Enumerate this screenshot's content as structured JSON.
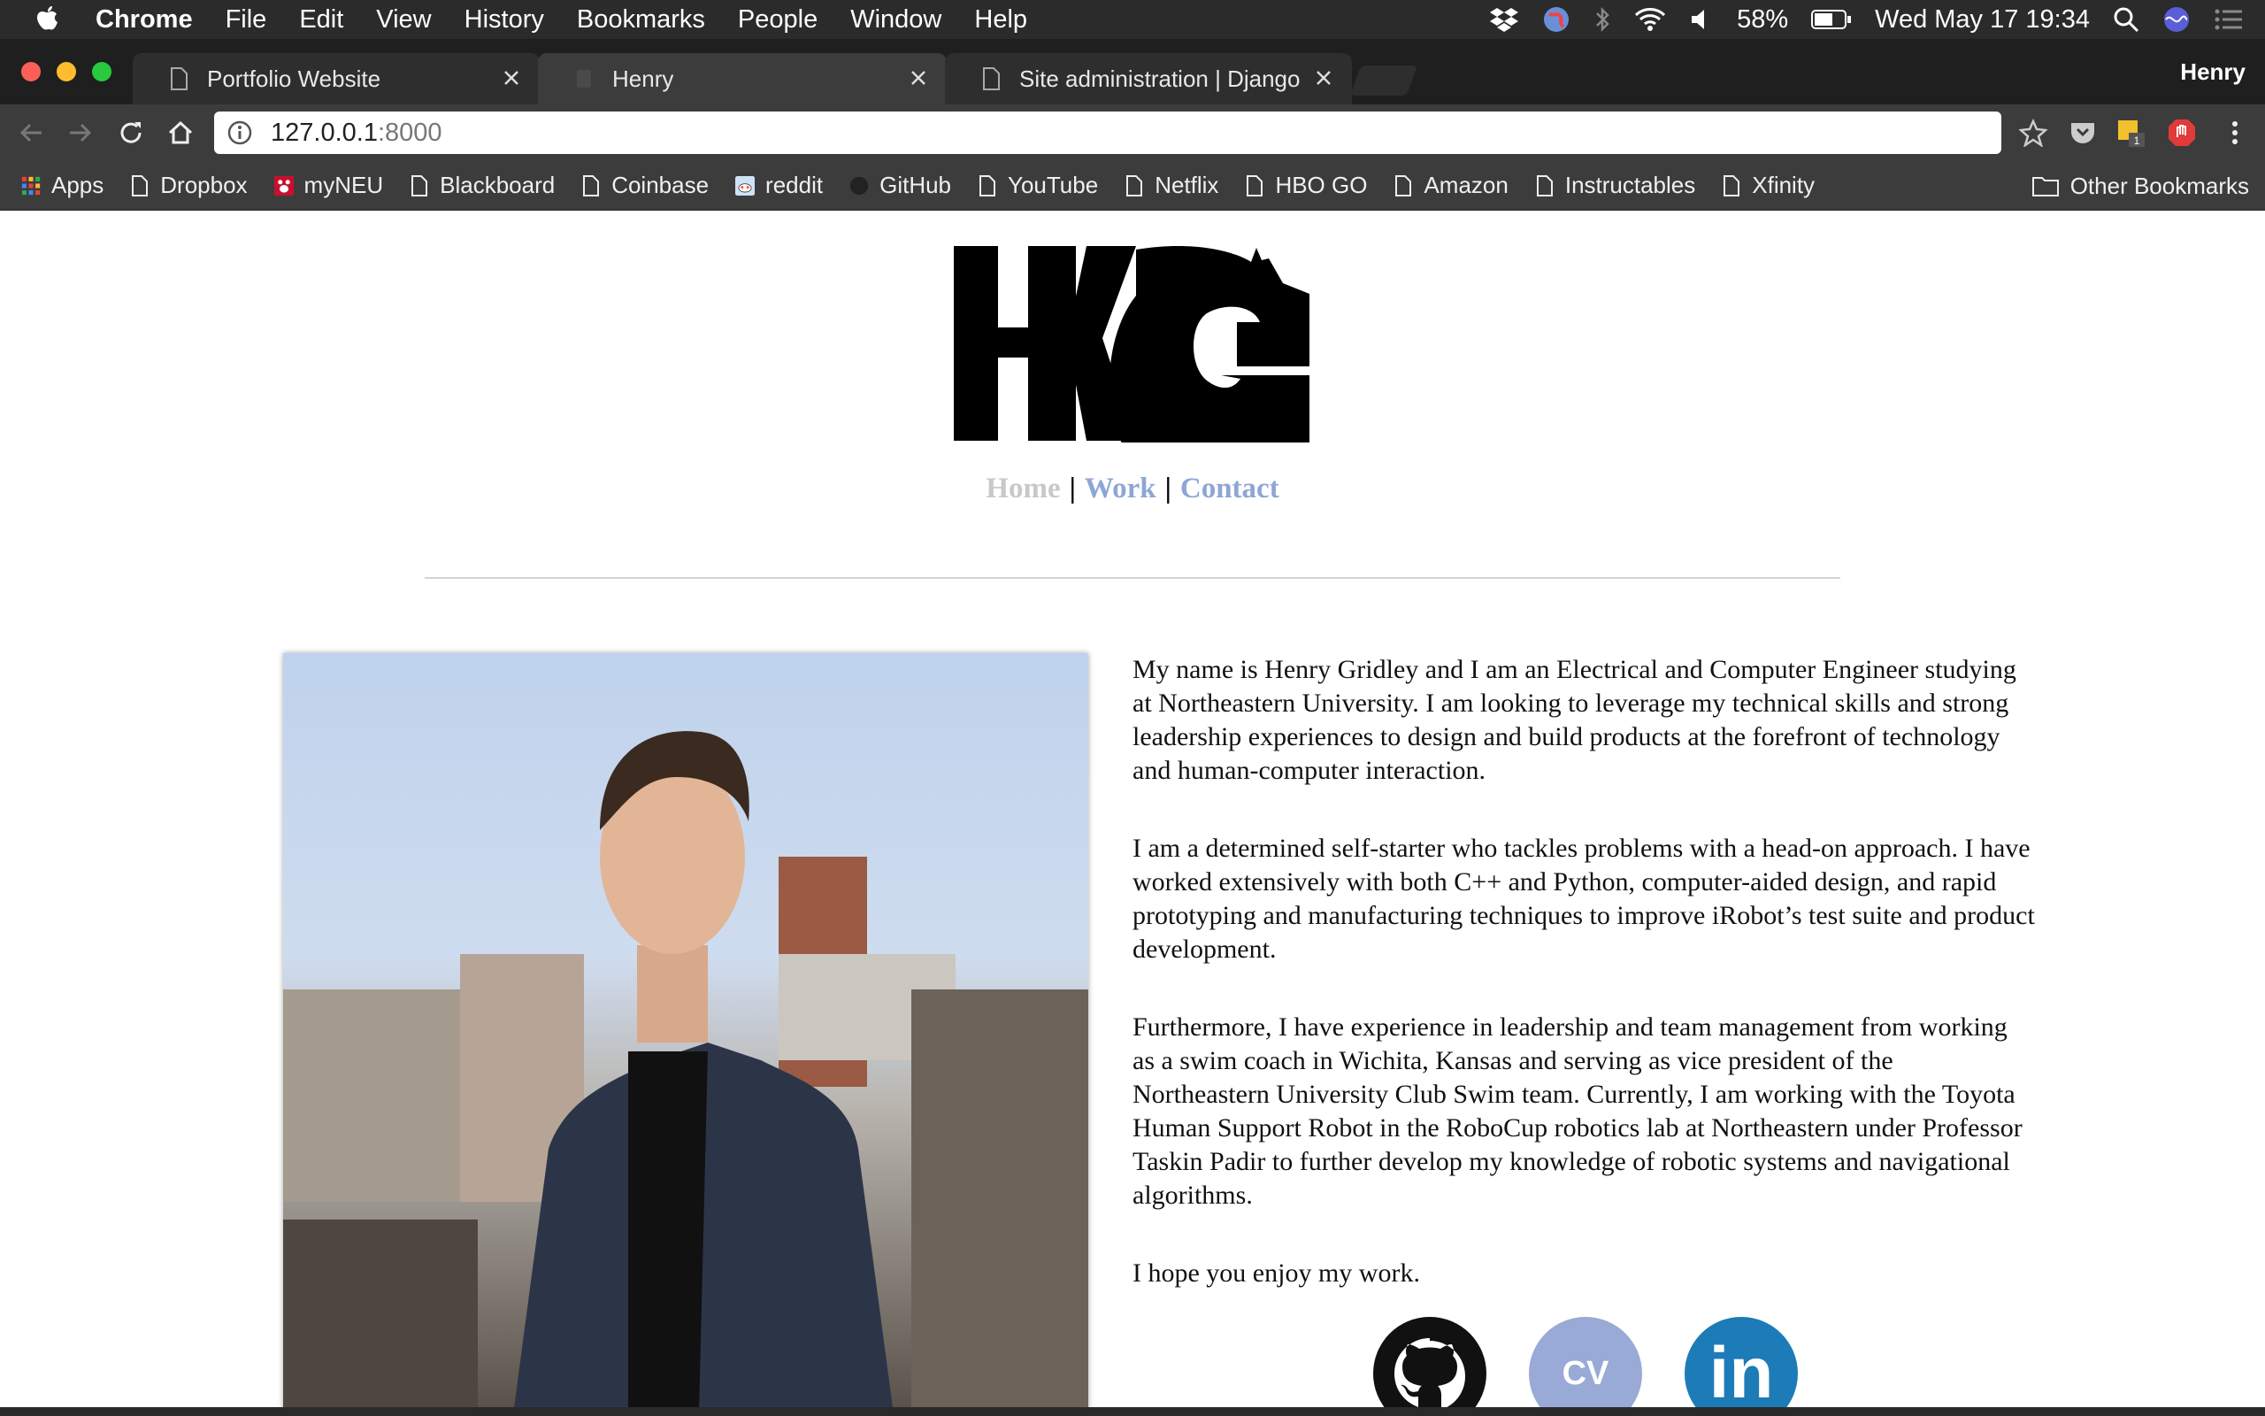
{
  "menubar": {
    "app": "Chrome",
    "items": [
      "File",
      "Edit",
      "View",
      "History",
      "Bookmarks",
      "People",
      "Window",
      "Help"
    ],
    "battery": "58%",
    "datetime": "Wed May 17  19:34",
    "icons": [
      "dropbox-icon",
      "globe-icon",
      "bluetooth-icon",
      "wifi-icon",
      "volume-icon",
      "battery-icon",
      "spotlight-icon",
      "siri-icon",
      "notification-center-icon"
    ]
  },
  "tabs": [
    {
      "title": "Portfolio Website",
      "active": false
    },
    {
      "title": "Henry",
      "active": true
    },
    {
      "title": "Site administration | Django sit",
      "active": false
    }
  ],
  "profile": {
    "name": "Henry"
  },
  "omnibox": {
    "host": "127.0.0.1",
    "port": ":8000"
  },
  "bookmarks": {
    "apps": "Apps",
    "items": [
      "Dropbox",
      "myNEU",
      "Blackboard",
      "Coinbase",
      "reddit",
      "GitHub",
      "YouTube",
      "Netflix",
      "HBO GO",
      "Amazon",
      "Instructables",
      "Xfinity"
    ],
    "other": "Other Bookmarks"
  },
  "page": {
    "logo_text": "HKG",
    "nav": {
      "home": "Home",
      "work": "Work",
      "contact": "Contact",
      "separator": "|"
    },
    "bio": [
      "My name is Henry Gridley and I am an Electrical and Computer Engineer studying at Northeastern University. I am looking to leverage my technical skills and strong leadership experiences to design and build products at the forefront of technology and human-computer interaction.",
      "I am a determined self-starter who tackles problems with a head-on approach. I have worked extensively with both C++ and Python, computer-aided design, and rapid prototyping and manufacturing techniques to improve iRobot’s test suite and product development.",
      "Furthermore, I have experience in leadership and team management from working as a swim coach in Wichita, Kansas and serving as vice president of the Northeastern University Club Swim team. Currently, I am working with the Toyota Human Support Robot in the RoboCup robotics lab at Northeastern under Professor Taskin Padir to further develop my knowledge of robotic systems and navigational algorithms.",
      "I hope you enjoy my work."
    ],
    "social": {
      "cv": "CV",
      "linkedin": "in"
    }
  },
  "colors": {
    "nav_link": "#8ea6d4",
    "nav_home": "#c8c8c8",
    "cv_button": "#9aaad6",
    "linkedin": "#1d7bb7"
  }
}
